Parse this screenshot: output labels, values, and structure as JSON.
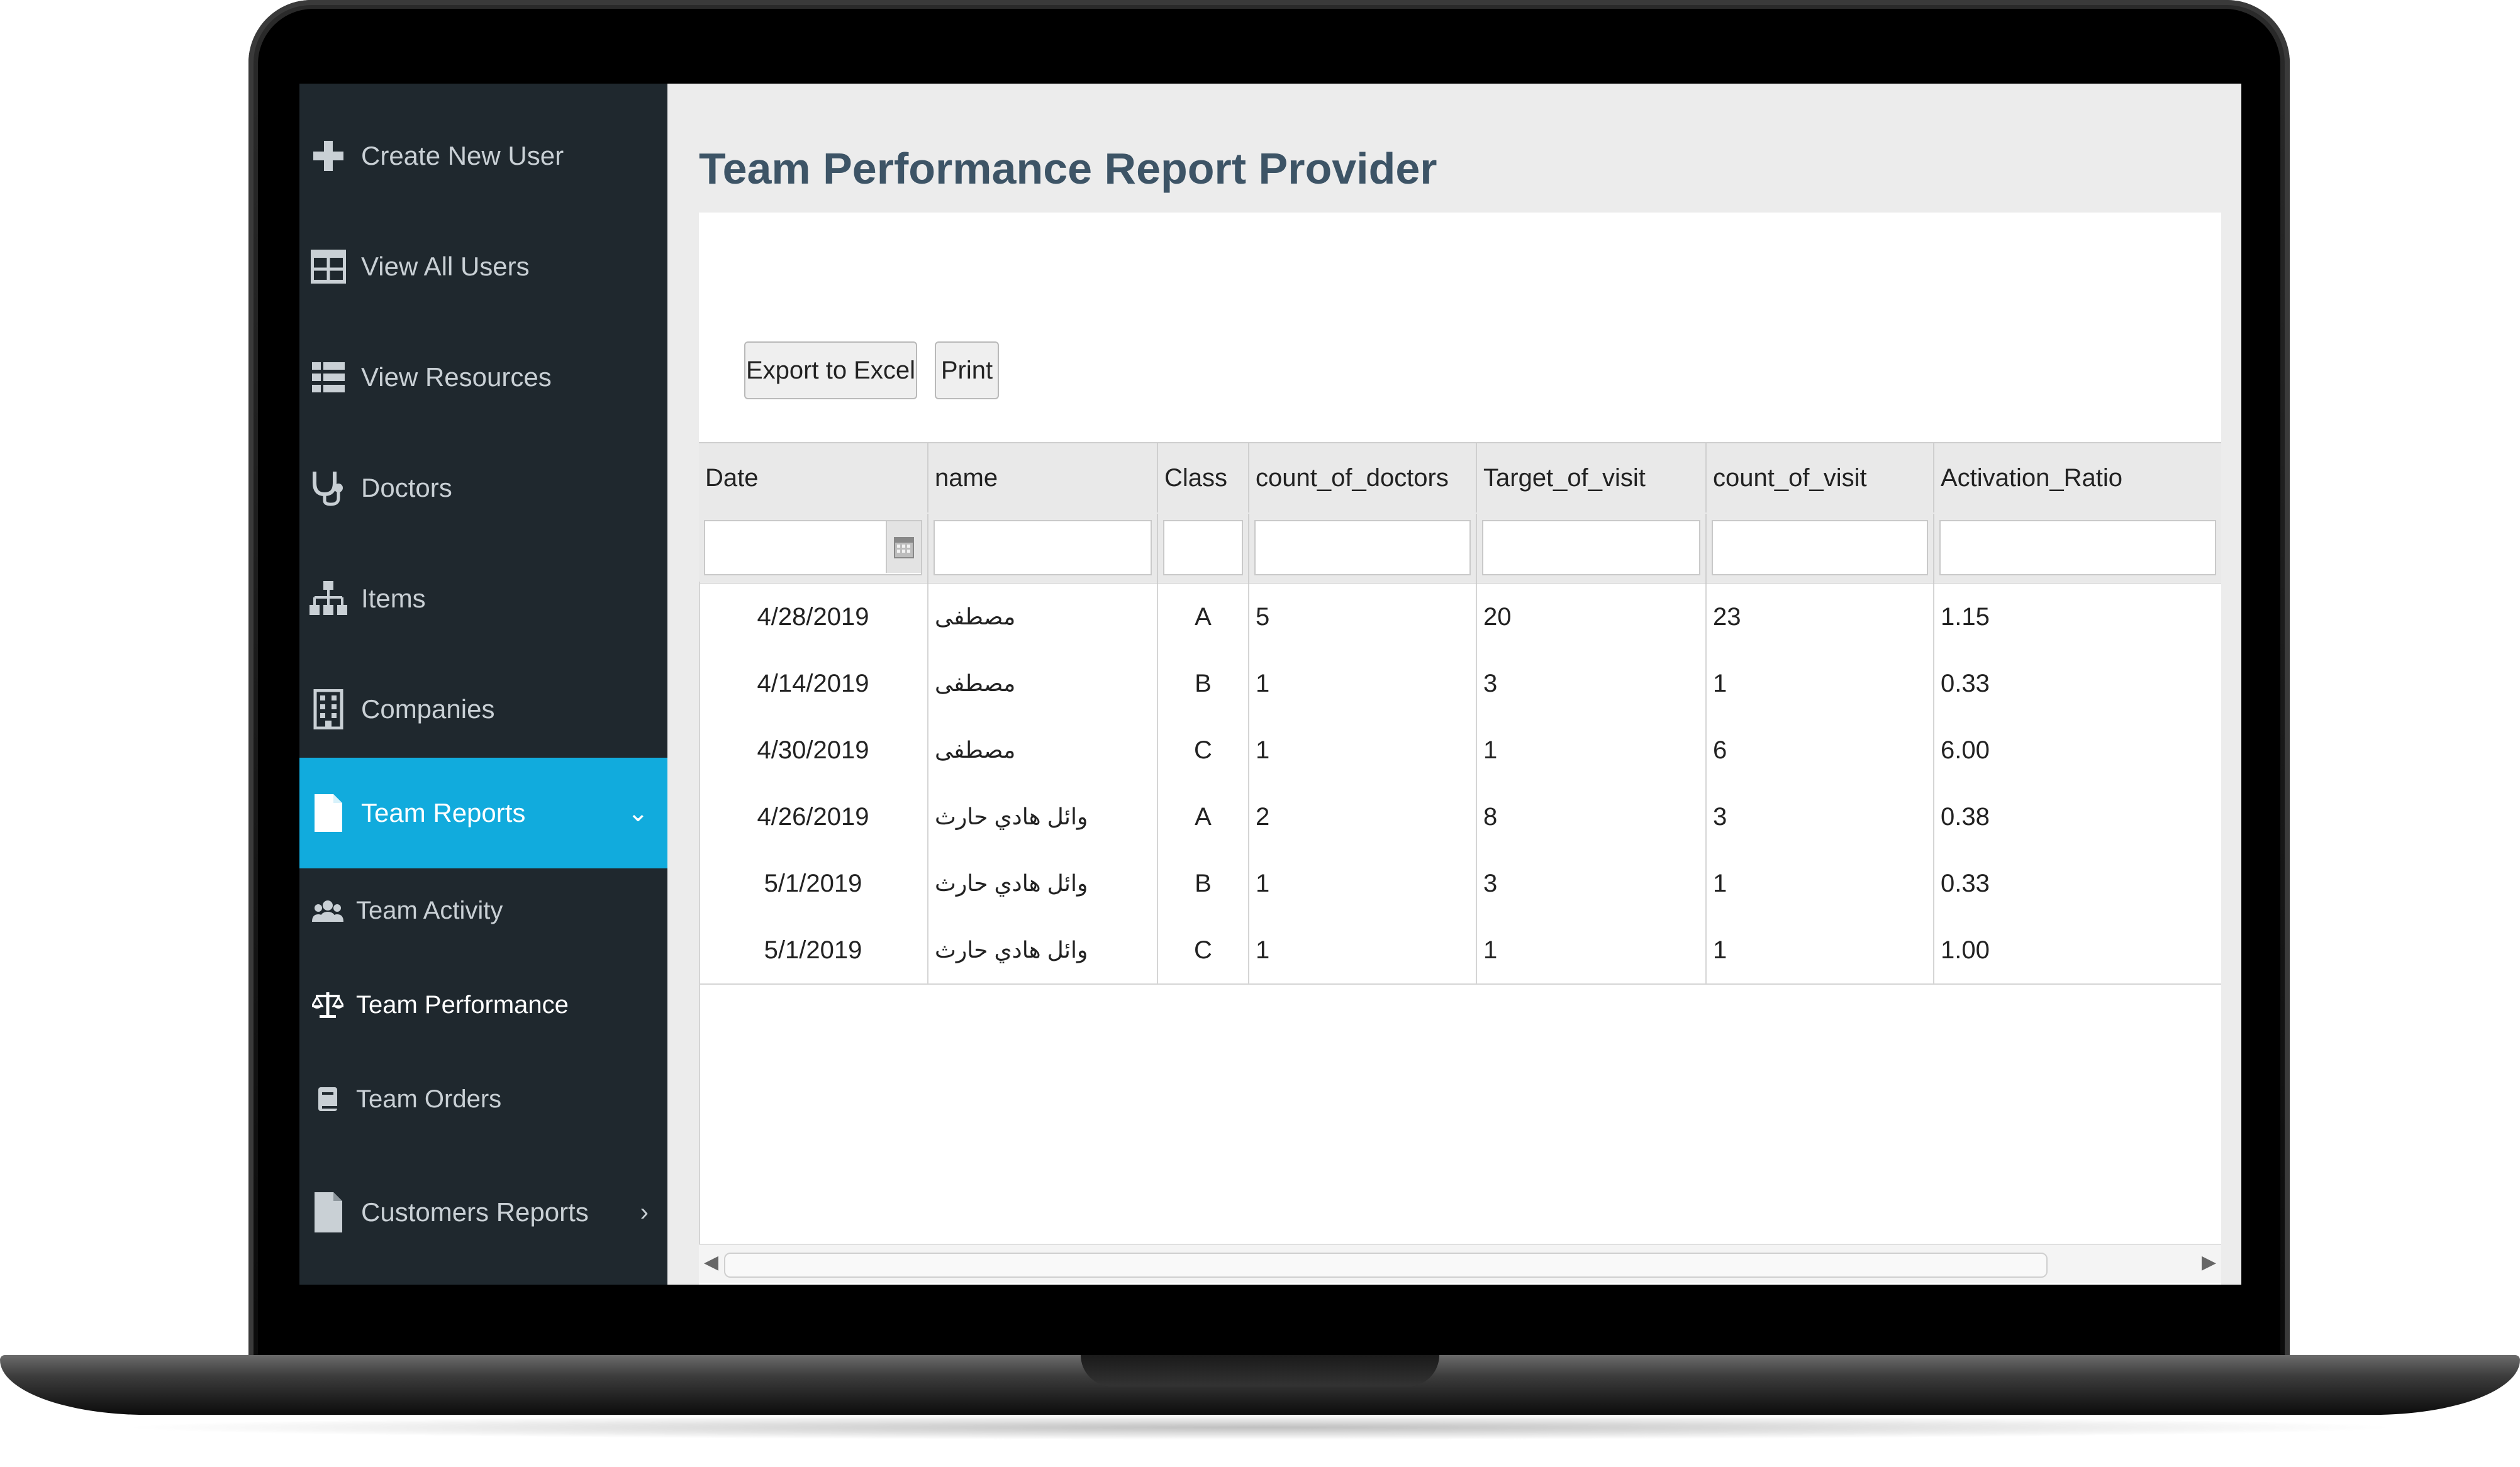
{
  "sidebar": {
    "items": [
      {
        "label": "Create New User",
        "icon": "plus-icon"
      },
      {
        "label": "View All Users",
        "icon": "table-icon"
      },
      {
        "label": "View Resources",
        "icon": "list-icon"
      },
      {
        "label": "Doctors",
        "icon": "stethoscope-icon"
      },
      {
        "label": "Items",
        "icon": "sitemap-icon"
      },
      {
        "label": "Companies",
        "icon": "building-icon"
      },
      {
        "label": "Team Reports",
        "icon": "file-icon",
        "active": true,
        "chevron": "⌄"
      },
      {
        "label": "Customers Reports",
        "icon": "file-icon",
        "chevron": "›"
      }
    ],
    "subitems": [
      {
        "label": "Team Activity",
        "icon": "users-icon"
      },
      {
        "label": "Team Performance",
        "icon": "balance-scale-icon",
        "current": true
      },
      {
        "label": "Team Orders",
        "icon": "book-icon"
      }
    ],
    "active_color": "#11abdd",
    "bg_color": "#1f282e"
  },
  "page": {
    "title": "Team Performance Report Provider"
  },
  "toolbar": {
    "export_label": "Export to Excel",
    "print_label": "Print"
  },
  "table": {
    "columns": [
      "Date",
      "name",
      "Class",
      "count_of_doctors",
      "Target_of_visit",
      "count_of_visit",
      "Activation_Ratio"
    ],
    "rows": [
      [
        "4/28/2019",
        "مصطفى",
        "A",
        "5",
        "20",
        "23",
        "1.15"
      ],
      [
        "4/14/2019",
        "مصطفى",
        "B",
        "1",
        "3",
        "1",
        "0.33"
      ],
      [
        "4/30/2019",
        "مصطفى",
        "C",
        "1",
        "1",
        "6",
        "6.00"
      ],
      [
        "4/26/2019",
        "وائل هادي حارث",
        "A",
        "2",
        "8",
        "3",
        "0.38"
      ],
      [
        "5/1/2019",
        "وائل هادي حارث",
        "B",
        "1",
        "3",
        "1",
        "0.33"
      ],
      [
        "5/1/2019",
        "وائل هادي حارث",
        "C",
        "1",
        "1",
        "1",
        "1.00"
      ]
    ]
  }
}
